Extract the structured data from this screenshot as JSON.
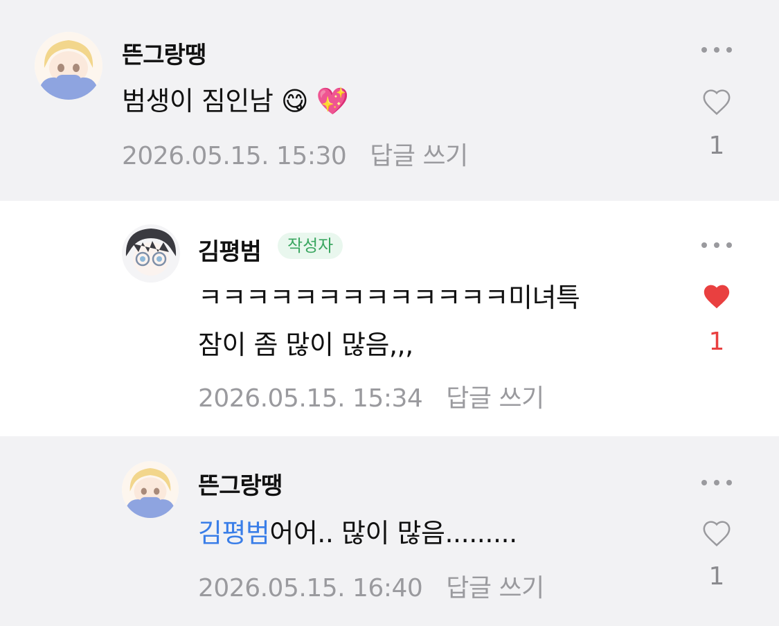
{
  "comments": [
    {
      "author": "뜬그랑땡",
      "badge": "",
      "mention": "",
      "text": "범생이 짐인남",
      "emoji": "😋 💖",
      "timestamp": "2026.05.15. 15:30",
      "reply_label": "답글 쓰기",
      "likes": "1",
      "liked": false
    },
    {
      "author": "김평범",
      "badge": "작성자",
      "mention": "",
      "text_line1": "ㅋㅋㅋㅋㅋㅋㅋㅋㅋㅋㅋㅋㅋ미녀특",
      "text_line2": "잠이 좀 많이 많음,,,",
      "timestamp": "2026.05.15. 15:34",
      "reply_label": "답글 쓰기",
      "likes": "1",
      "liked": true
    },
    {
      "author": "뜬그랑땡",
      "badge": "",
      "mention": "김평범",
      "text": "어어.. 많이 많음.........",
      "timestamp": "2026.05.15. 16:40",
      "reply_label": "답글 쓰기",
      "likes": "1",
      "liked": false
    }
  ],
  "colors": {
    "background": "#f2f2f4",
    "reply_background": "#ffffff",
    "badge_text": "#3aa660",
    "mention": "#3a7ee8",
    "liked_heart": "#e94040",
    "meta_text": "#9a9a9e"
  },
  "icons": [
    "more-icon",
    "heart-outline-icon",
    "heart-filled-icon"
  ]
}
